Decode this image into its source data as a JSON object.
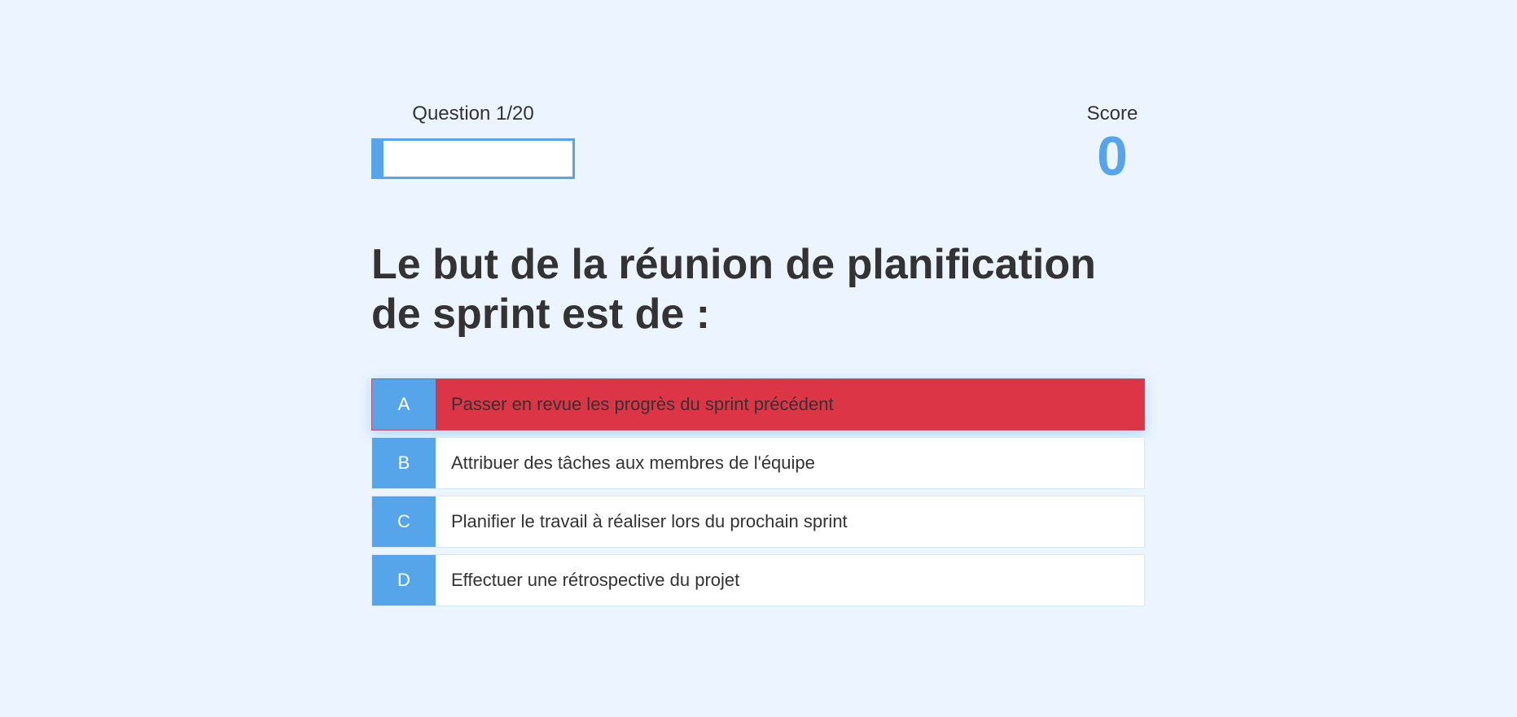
{
  "hud": {
    "progress_text": "Question 1/20",
    "progress_fraction": 0.05,
    "score_label": "Score",
    "score_value": "0"
  },
  "question": {
    "text": "Le but de la réunion de planification de sprint est de :"
  },
  "choices": [
    {
      "prefix": "A",
      "text": "Passer en revue les progrès du sprint précédent",
      "state": "incorrect"
    },
    {
      "prefix": "B",
      "text": "Attribuer des tâches aux membres de l'équipe",
      "state": "default"
    },
    {
      "prefix": "C",
      "text": "Planifier le travail à réaliser lors du prochain sprint",
      "state": "default"
    },
    {
      "prefix": "D",
      "text": "Effectuer une rétrospective du projet",
      "state": "default"
    }
  ],
  "colors": {
    "background": "#ebf4ff",
    "accent": "#56a5eb",
    "incorrect": "#dc3545",
    "text": "#333333"
  }
}
